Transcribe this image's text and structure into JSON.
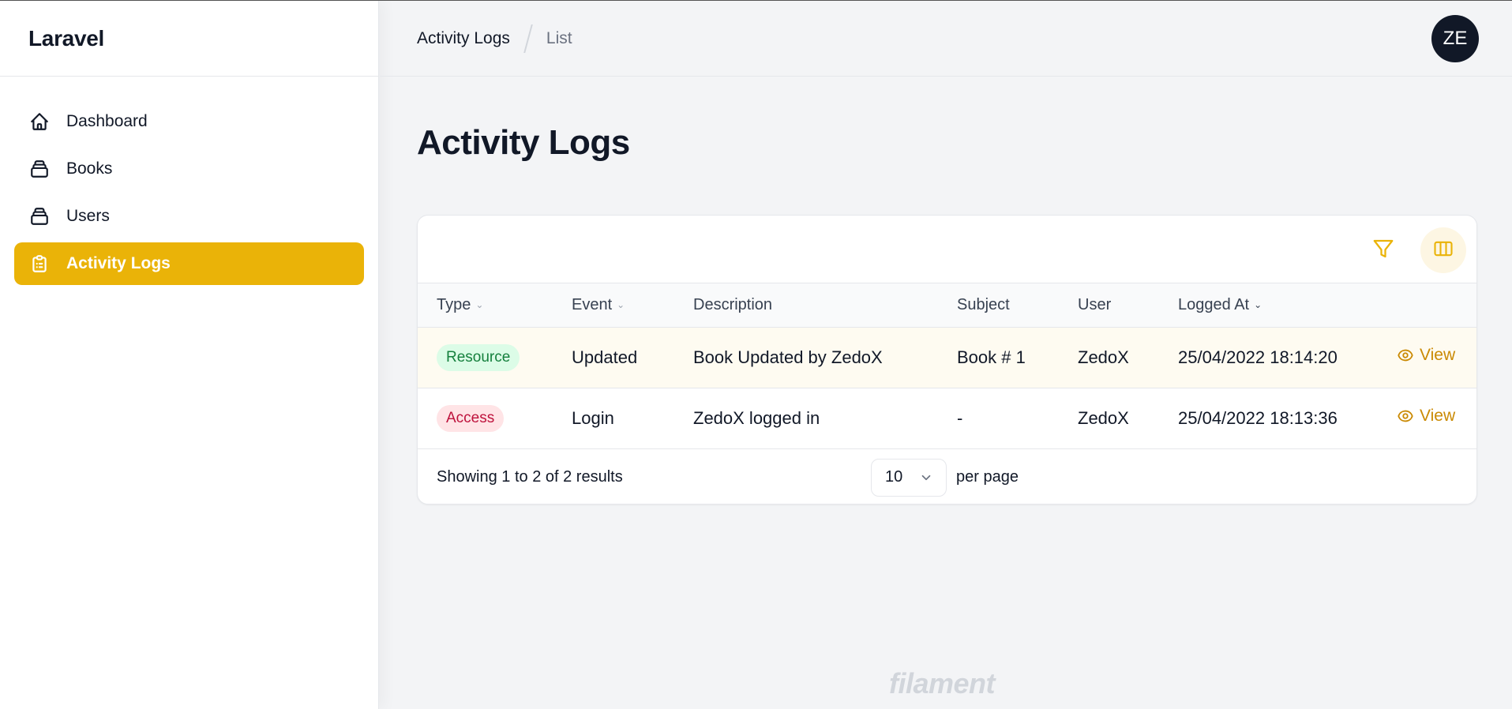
{
  "app": {
    "brand": "Laravel"
  },
  "sidebar": {
    "items": [
      {
        "label": "Dashboard",
        "icon": "home-icon",
        "active": false
      },
      {
        "label": "Books",
        "icon": "collection-icon",
        "active": false
      },
      {
        "label": "Users",
        "icon": "collection-icon",
        "active": false
      },
      {
        "label": "Activity Logs",
        "icon": "clipboard-list-icon",
        "active": true
      }
    ]
  },
  "header": {
    "breadcrumbs": [
      "Activity Logs",
      "List"
    ],
    "avatar_initials": "ZE"
  },
  "page": {
    "title": "Activity Logs"
  },
  "table": {
    "toolbar": {
      "filter_icon": "filter-icon",
      "columns_icon": "view-columns-icon"
    },
    "columns": [
      {
        "label": "Type",
        "sortable": true
      },
      {
        "label": "Event",
        "sortable": true
      },
      {
        "label": "Description",
        "sortable": false
      },
      {
        "label": "Subject",
        "sortable": false
      },
      {
        "label": "User",
        "sortable": false
      },
      {
        "label": "Logged At",
        "sortable": true,
        "sorted": "desc"
      }
    ],
    "rows": [
      {
        "type": "Resource",
        "type_color": "green",
        "event": "Updated",
        "description": "Book Updated by ZedoX",
        "subject": "Book # 1",
        "user": "ZedoX",
        "logged_at": "25/04/2022 18:14:20",
        "action": "View"
      },
      {
        "type": "Access",
        "type_color": "red",
        "event": "Login",
        "description": "ZedoX logged in",
        "subject": "-",
        "user": "ZedoX",
        "logged_at": "25/04/2022 18:13:36",
        "action": "View"
      }
    ],
    "footer": {
      "showing": "Showing 1 to 2 of 2 results",
      "per_page_value": "10",
      "per_page_label": "per page"
    }
  },
  "footer_brand": "filament",
  "colors": {
    "accent": "#eab308",
    "accent_text": "#ca8a04",
    "resource_badge": "#15803d",
    "access_badge": "#be123c",
    "avatar_bg": "#111827"
  }
}
